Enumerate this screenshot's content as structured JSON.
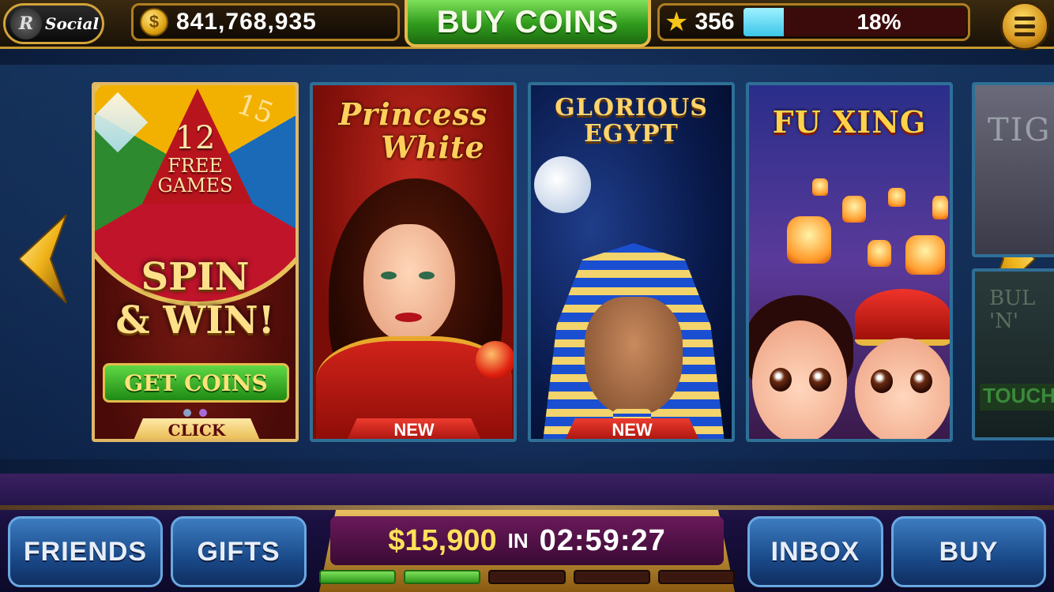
{
  "header": {
    "logo_mark": "R",
    "logo_text": "Social",
    "coin_symbol": "$",
    "coins": "841,768,935",
    "buy_coins_label": "BUY COINS",
    "level": "356",
    "xp_percent_label": "18%",
    "xp_fraction": 0.18
  },
  "carousel": {
    "tiles": [
      {
        "id": "spin-win",
        "wheel_number": "12",
        "wheel_line1": "FREE",
        "wheel_line2": "GAMES",
        "wheel_side": "15",
        "headline_line1": "SPIN",
        "headline_line2": "& WIN!",
        "button_label": "GET COINS",
        "badge": "CLICK",
        "page_count": 2,
        "active_page": 2
      },
      {
        "id": "princess-white",
        "title_line1": "Princess",
        "title_line2": "White",
        "badge": "NEW"
      },
      {
        "id": "glorious-egypt",
        "title_line1": "GLORIOUS",
        "title_line2": "EGYPT",
        "badge": "NEW"
      },
      {
        "id": "fu-xing",
        "title": "FU XING"
      }
    ],
    "partial_tiles": [
      {
        "id": "tiger",
        "title": "TIG"
      },
      {
        "id": "bull",
        "title_line1": "BUL",
        "title_line2": "'N'",
        "overlay": "TOUCH T"
      }
    ]
  },
  "footer": {
    "friends_label": "FRIENDS",
    "gifts_label": "GIFTS",
    "inbox_label": "INBOX",
    "buy_label": "BUY",
    "bonus_amount": "$15,900",
    "bonus_in": "IN",
    "bonus_timer": "02:59:27",
    "bonus_segments_total": 5,
    "bonus_segments_filled": 2
  },
  "colors": {
    "accent_gold": "#e8c060",
    "buy_green": "#2f9a1c",
    "nav_blue": "#1a4a8a",
    "badge_red": "#d0231a"
  }
}
